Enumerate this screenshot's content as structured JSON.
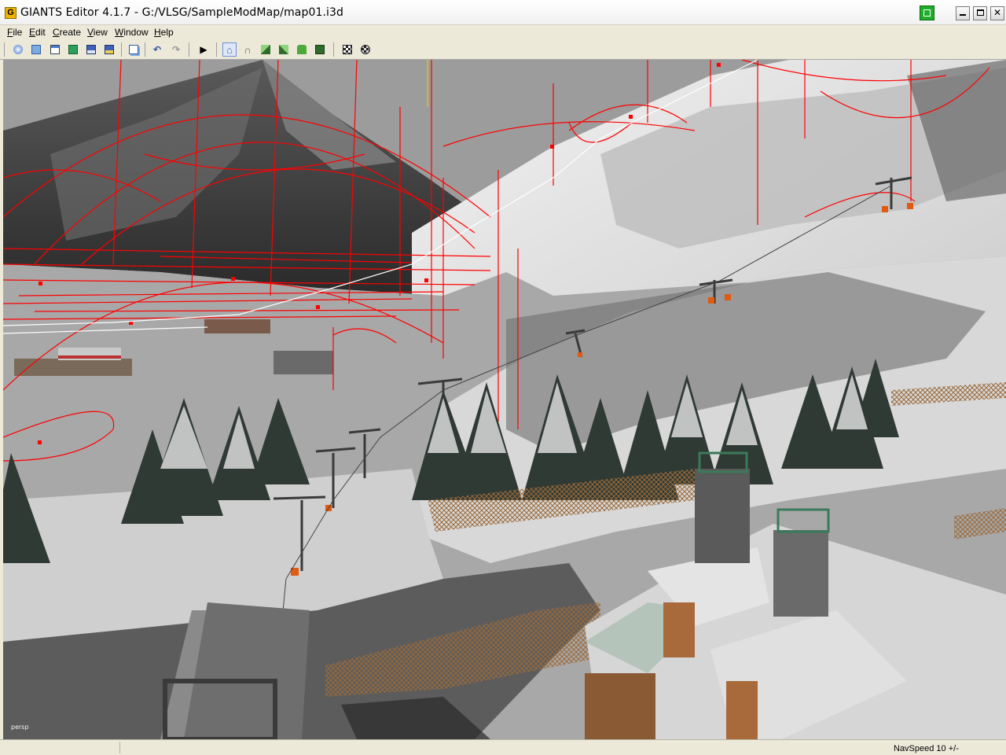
{
  "window": {
    "title": "GIANTS Editor 4.1.7 - G:/VLSG/SampleModMap/map01.i3d",
    "app_icon_glyph": "G",
    "buttons": [
      "minimize",
      "maximize",
      "close"
    ]
  },
  "menu": {
    "file": {
      "mnemonic": "F",
      "rest": "ile"
    },
    "edit": {
      "mnemonic": "E",
      "rest": "dit"
    },
    "create": {
      "mnemonic": "C",
      "rest": "reate"
    },
    "view": {
      "mnemonic": "V",
      "rest": "iew"
    },
    "window": {
      "mnemonic": "W",
      "rest": "indow"
    },
    "help": {
      "mnemonic": "H",
      "rest": "elp"
    }
  },
  "toolbar": {
    "icons": [
      "new-scene-icon",
      "open-icon",
      "import-icon",
      "reload-icon",
      "save-icon",
      "save-as-icon",
      "copy-icon",
      "undo-icon",
      "redo-icon",
      "play-icon",
      "home-view-icon",
      "magnet-icon",
      "terrain-sculpt-icon",
      "terrain-paint-icon",
      "foliage-paint-icon",
      "object-place-icon",
      "bake-icon",
      "settings-icon"
    ],
    "active": "home-view-icon",
    "play_glyph": "▶"
  },
  "viewport": {
    "camera_label": "persp",
    "colors": {
      "sky": "#9a9a9a",
      "snow": "#e8e8e8",
      "rock": "#3c3c3c",
      "gizmo": "#ff0000",
      "fence": "#9a6a3a",
      "tree": "#2f3a34"
    }
  },
  "status": {
    "nav_speed": "NavSpeed 10 +/-"
  }
}
